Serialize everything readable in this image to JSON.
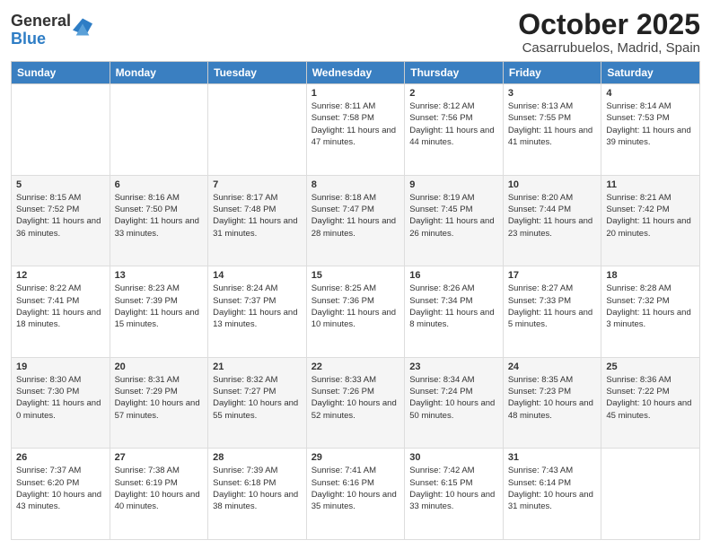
{
  "header": {
    "logo_general": "General",
    "logo_blue": "Blue",
    "title": "October 2025",
    "subtitle": "Casarrubuelos, Madrid, Spain"
  },
  "weekdays": [
    "Sunday",
    "Monday",
    "Tuesday",
    "Wednesday",
    "Thursday",
    "Friday",
    "Saturday"
  ],
  "weeks": [
    [
      {
        "day": "",
        "sunrise": "",
        "sunset": "",
        "daylight": ""
      },
      {
        "day": "",
        "sunrise": "",
        "sunset": "",
        "daylight": ""
      },
      {
        "day": "",
        "sunrise": "",
        "sunset": "",
        "daylight": ""
      },
      {
        "day": "1",
        "sunrise": "Sunrise: 8:11 AM",
        "sunset": "Sunset: 7:58 PM",
        "daylight": "Daylight: 11 hours and 47 minutes."
      },
      {
        "day": "2",
        "sunrise": "Sunrise: 8:12 AM",
        "sunset": "Sunset: 7:56 PM",
        "daylight": "Daylight: 11 hours and 44 minutes."
      },
      {
        "day": "3",
        "sunrise": "Sunrise: 8:13 AM",
        "sunset": "Sunset: 7:55 PM",
        "daylight": "Daylight: 11 hours and 41 minutes."
      },
      {
        "day": "4",
        "sunrise": "Sunrise: 8:14 AM",
        "sunset": "Sunset: 7:53 PM",
        "daylight": "Daylight: 11 hours and 39 minutes."
      }
    ],
    [
      {
        "day": "5",
        "sunrise": "Sunrise: 8:15 AM",
        "sunset": "Sunset: 7:52 PM",
        "daylight": "Daylight: 11 hours and 36 minutes."
      },
      {
        "day": "6",
        "sunrise": "Sunrise: 8:16 AM",
        "sunset": "Sunset: 7:50 PM",
        "daylight": "Daylight: 11 hours and 33 minutes."
      },
      {
        "day": "7",
        "sunrise": "Sunrise: 8:17 AM",
        "sunset": "Sunset: 7:48 PM",
        "daylight": "Daylight: 11 hours and 31 minutes."
      },
      {
        "day": "8",
        "sunrise": "Sunrise: 8:18 AM",
        "sunset": "Sunset: 7:47 PM",
        "daylight": "Daylight: 11 hours and 28 minutes."
      },
      {
        "day": "9",
        "sunrise": "Sunrise: 8:19 AM",
        "sunset": "Sunset: 7:45 PM",
        "daylight": "Daylight: 11 hours and 26 minutes."
      },
      {
        "day": "10",
        "sunrise": "Sunrise: 8:20 AM",
        "sunset": "Sunset: 7:44 PM",
        "daylight": "Daylight: 11 hours and 23 minutes."
      },
      {
        "day": "11",
        "sunrise": "Sunrise: 8:21 AM",
        "sunset": "Sunset: 7:42 PM",
        "daylight": "Daylight: 11 hours and 20 minutes."
      }
    ],
    [
      {
        "day": "12",
        "sunrise": "Sunrise: 8:22 AM",
        "sunset": "Sunset: 7:41 PM",
        "daylight": "Daylight: 11 hours and 18 minutes."
      },
      {
        "day": "13",
        "sunrise": "Sunrise: 8:23 AM",
        "sunset": "Sunset: 7:39 PM",
        "daylight": "Daylight: 11 hours and 15 minutes."
      },
      {
        "day": "14",
        "sunrise": "Sunrise: 8:24 AM",
        "sunset": "Sunset: 7:37 PM",
        "daylight": "Daylight: 11 hours and 13 minutes."
      },
      {
        "day": "15",
        "sunrise": "Sunrise: 8:25 AM",
        "sunset": "Sunset: 7:36 PM",
        "daylight": "Daylight: 11 hours and 10 minutes."
      },
      {
        "day": "16",
        "sunrise": "Sunrise: 8:26 AM",
        "sunset": "Sunset: 7:34 PM",
        "daylight": "Daylight: 11 hours and 8 minutes."
      },
      {
        "day": "17",
        "sunrise": "Sunrise: 8:27 AM",
        "sunset": "Sunset: 7:33 PM",
        "daylight": "Daylight: 11 hours and 5 minutes."
      },
      {
        "day": "18",
        "sunrise": "Sunrise: 8:28 AM",
        "sunset": "Sunset: 7:32 PM",
        "daylight": "Daylight: 11 hours and 3 minutes."
      }
    ],
    [
      {
        "day": "19",
        "sunrise": "Sunrise: 8:30 AM",
        "sunset": "Sunset: 7:30 PM",
        "daylight": "Daylight: 11 hours and 0 minutes."
      },
      {
        "day": "20",
        "sunrise": "Sunrise: 8:31 AM",
        "sunset": "Sunset: 7:29 PM",
        "daylight": "Daylight: 10 hours and 57 minutes."
      },
      {
        "day": "21",
        "sunrise": "Sunrise: 8:32 AM",
        "sunset": "Sunset: 7:27 PM",
        "daylight": "Daylight: 10 hours and 55 minutes."
      },
      {
        "day": "22",
        "sunrise": "Sunrise: 8:33 AM",
        "sunset": "Sunset: 7:26 PM",
        "daylight": "Daylight: 10 hours and 52 minutes."
      },
      {
        "day": "23",
        "sunrise": "Sunrise: 8:34 AM",
        "sunset": "Sunset: 7:24 PM",
        "daylight": "Daylight: 10 hours and 50 minutes."
      },
      {
        "day": "24",
        "sunrise": "Sunrise: 8:35 AM",
        "sunset": "Sunset: 7:23 PM",
        "daylight": "Daylight: 10 hours and 48 minutes."
      },
      {
        "day": "25",
        "sunrise": "Sunrise: 8:36 AM",
        "sunset": "Sunset: 7:22 PM",
        "daylight": "Daylight: 10 hours and 45 minutes."
      }
    ],
    [
      {
        "day": "26",
        "sunrise": "Sunrise: 7:37 AM",
        "sunset": "Sunset: 6:20 PM",
        "daylight": "Daylight: 10 hours and 43 minutes."
      },
      {
        "day": "27",
        "sunrise": "Sunrise: 7:38 AM",
        "sunset": "Sunset: 6:19 PM",
        "daylight": "Daylight: 10 hours and 40 minutes."
      },
      {
        "day": "28",
        "sunrise": "Sunrise: 7:39 AM",
        "sunset": "Sunset: 6:18 PM",
        "daylight": "Daylight: 10 hours and 38 minutes."
      },
      {
        "day": "29",
        "sunrise": "Sunrise: 7:41 AM",
        "sunset": "Sunset: 6:16 PM",
        "daylight": "Daylight: 10 hours and 35 minutes."
      },
      {
        "day": "30",
        "sunrise": "Sunrise: 7:42 AM",
        "sunset": "Sunset: 6:15 PM",
        "daylight": "Daylight: 10 hours and 33 minutes."
      },
      {
        "day": "31",
        "sunrise": "Sunrise: 7:43 AM",
        "sunset": "Sunset: 6:14 PM",
        "daylight": "Daylight: 10 hours and 31 minutes."
      },
      {
        "day": "",
        "sunrise": "",
        "sunset": "",
        "daylight": ""
      }
    ]
  ]
}
